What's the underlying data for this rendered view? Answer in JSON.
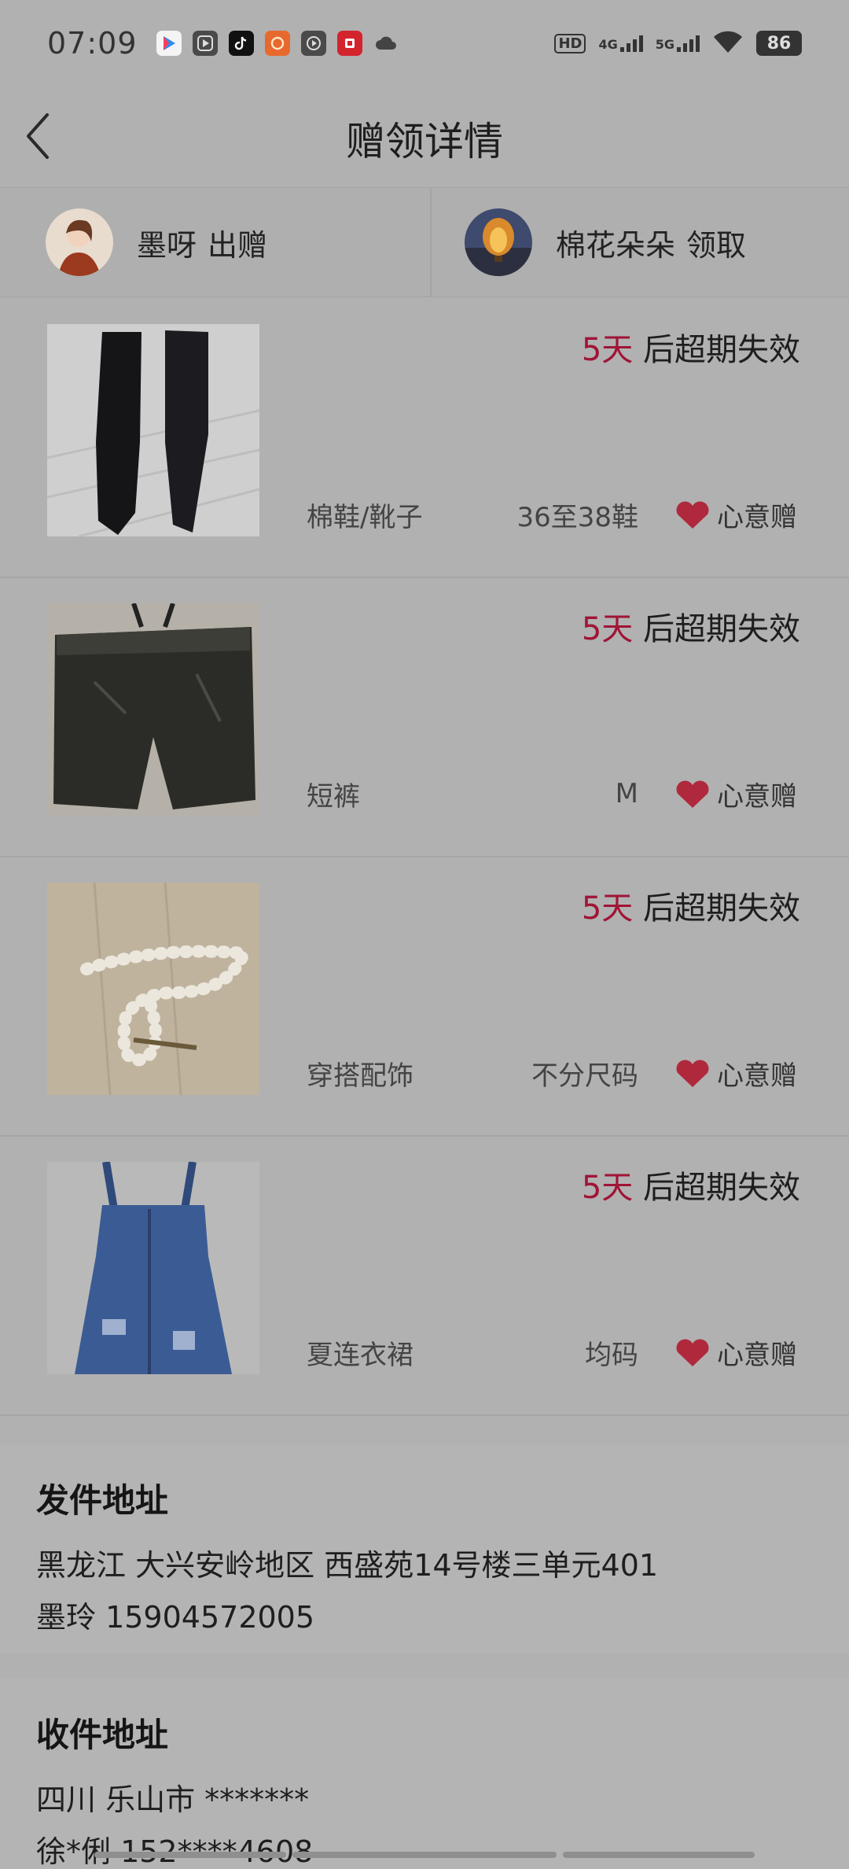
{
  "status": {
    "time": "07:09",
    "network_hd": "HD",
    "network_4g": "4G",
    "network_5g": "5G",
    "battery": "86",
    "apps": [
      "youku-icon",
      "play-icon",
      "tiktok-icon",
      "taobao-icon",
      "video-icon",
      "pdd-icon",
      "cloud-icon"
    ]
  },
  "header": {
    "title": "赠领详情"
  },
  "giver": {
    "name": "墨呀",
    "role": "出赠"
  },
  "receiver": {
    "name": "棉花朵朵",
    "role": "领取"
  },
  "items": [
    {
      "days": "5天",
      "expiry_suffix": "后超期失效",
      "category": "棉鞋/靴子",
      "size": "36至38鞋",
      "tag": "心意赠",
      "photo": "black-boots"
    },
    {
      "days": "5天",
      "expiry_suffix": "后超期失效",
      "category": "短裤",
      "size": "M",
      "tag": "心意赠",
      "photo": "leather-shorts"
    },
    {
      "days": "5天",
      "expiry_suffix": "后超期失效",
      "category": "穿搭配饰",
      "size": "不分尺码",
      "tag": "心意赠",
      "photo": "pearl-hairclip"
    },
    {
      "days": "5天",
      "expiry_suffix": "后超期失效",
      "category": "夏连衣裙",
      "size": "均码",
      "tag": "心意赠",
      "photo": "denim-overall-dress"
    }
  ],
  "sender_address": {
    "title": "发件地址",
    "line1": "黑龙江 大兴安岭地区 西盛苑14号楼三单元401",
    "line2": "墨玲 15904572005"
  },
  "receiver_address": {
    "title": "收件地址",
    "line1": "四川 乐山市 *******",
    "line2": "徐*俐 152****4608"
  },
  "colors": {
    "background": "#b1b1b1",
    "accent_days": "#a01436",
    "heart": "#b0283c"
  }
}
